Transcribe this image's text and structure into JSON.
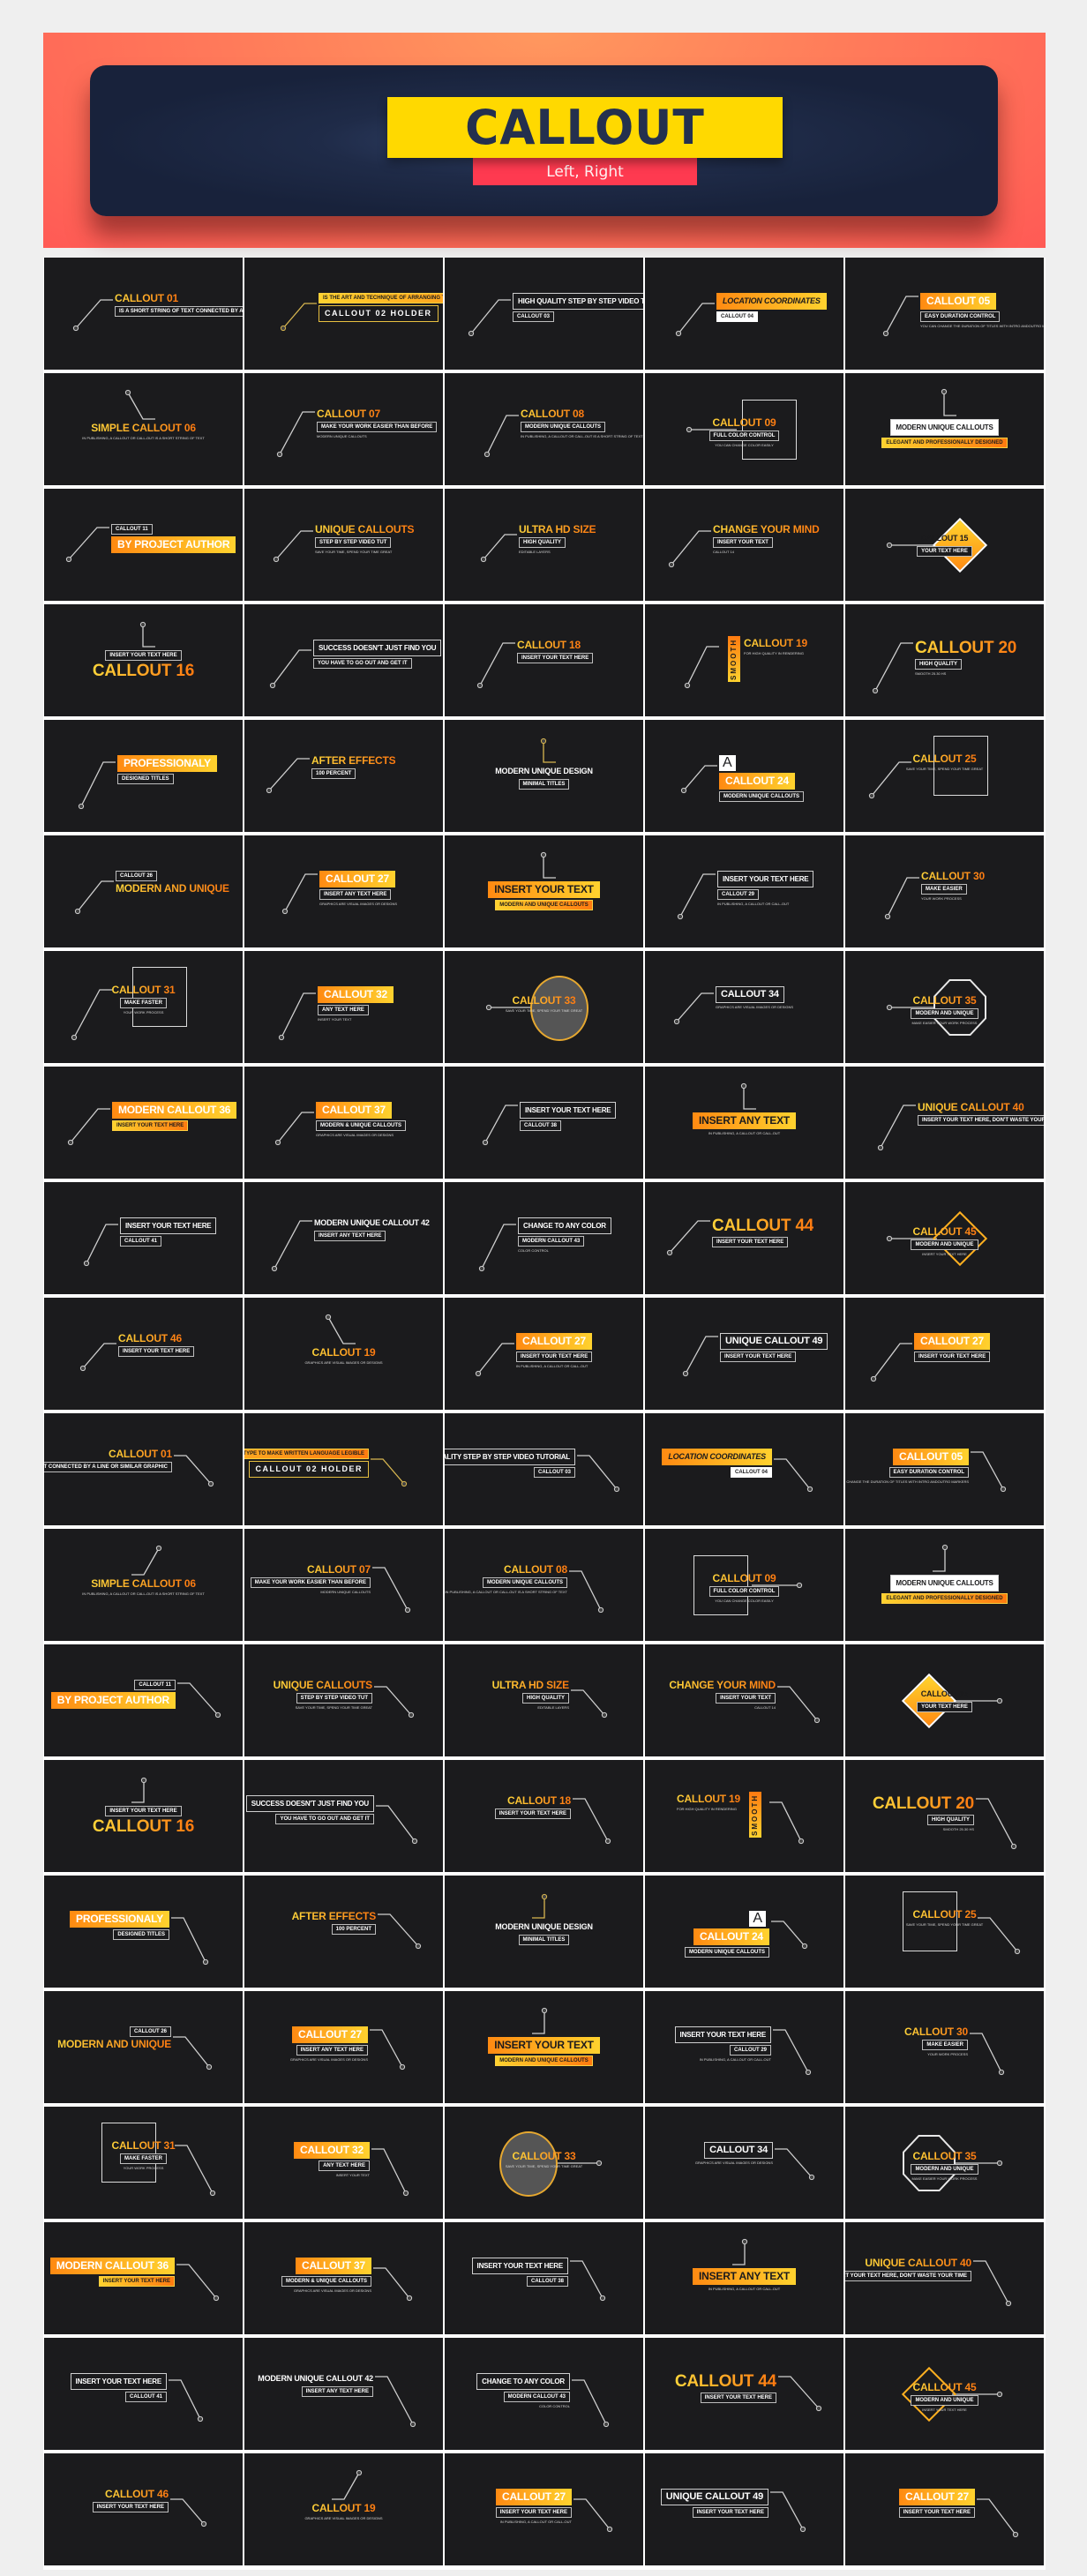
{
  "header": {
    "title": "CALLOUT",
    "subtitle": "Left, Right",
    "colors": {
      "title_bg": "#ffd900",
      "title_text": "#24304e",
      "subtitle_bg": "#fe3a50",
      "banner_gradient": [
        "#ff985e",
        "#ff5a55"
      ],
      "panel": "#1f2b48"
    }
  },
  "grid": {
    "tile_bg": "#1b1b1d",
    "accent_gradient": [
      "#ffd43a",
      "#ff7a10"
    ],
    "tiles_left": [
      {
        "n": 1,
        "title": "CALLOUT 01",
        "sub": "IS A SHORT STRING OF TEXT CONNECTED BY A LINE OR SIMILAR GRAPHIC",
        "style": "line"
      },
      {
        "n": 2,
        "title": "CALLOUT 02 HOLDER",
        "sub": "IS THE ART AND TECHNIQUE OF ARRANGING TYPE TO MAKE WRITTEN LANGUAGE LEGIBLE",
        "style": "holder"
      },
      {
        "n": 3,
        "title": "HIGH QUALITY STEP BY STEP VIDEO TUTORIAL",
        "sub": "CALLOUT 03",
        "style": "boxed"
      },
      {
        "n": 4,
        "title": "LOCATION COORDINATES",
        "sub": "CALLOUT 04",
        "style": "barwhite"
      },
      {
        "n": 5,
        "title": "CALLOUT 05",
        "sub": "EASY DURATION CONTROL",
        "body": "YOU CAN CHANGE THE DURATION OF TITLES WITH INTRO ANDOUTRO MARKERS",
        "style": "bar"
      },
      {
        "n": 6,
        "title": "SIMPLE CALLOUT 06",
        "body": "IN PUBLISHING, A CALLOUT OR CALL-OUT IS A SHORT STRING OF TEXT",
        "style": "bottom"
      },
      {
        "n": 7,
        "title": "CALLOUT 07",
        "sub": "MAKE YOUR WORK EASIER THAN BEFORE",
        "body": "MODERN UNIQUE CALLOUTS",
        "style": "line"
      },
      {
        "n": 8,
        "title": "CALLOUT 08",
        "sub": "MODERN UNIQUE CALLOUTS",
        "body": "IN PUBLISHING, A CALLOUT OR CALL-OUT IS A SHORT STRING OF TEXT",
        "style": "line"
      },
      {
        "n": 9,
        "title": "CALLOUT 09",
        "sub": "FULL COLOR CONTROL",
        "body": "YOU CAN CHANGE COLOR EASILY",
        "style": "frame"
      },
      {
        "n": 10,
        "title": "MODERN UNIQUE CALLOUTS",
        "sub": "ELEGANT AND PROFESSIONALLY DESIGNED",
        "style": "topwhite"
      },
      {
        "n": 11,
        "title": "BY PROJECT AUTHOR",
        "sub": "CALLOUT 11",
        "style": "bar"
      },
      {
        "n": 12,
        "title": "UNIQUE CALLOUTS",
        "sub": "STEP BY STEP VIDEO TUT",
        "body": "SAVE YOUR TIME, SPEND YOUR TIME GREAT",
        "style": "line"
      },
      {
        "n": 13,
        "title": "ULTRA HD SIZE",
        "sub": "HIGH QUALITY",
        "body": "EDITABLE LAYERS",
        "style": "line"
      },
      {
        "n": 14,
        "title": "CHANGE YOUR MIND",
        "sub": "INSERT YOUR TEXT",
        "body": "CALLOUT 14",
        "style": "line"
      },
      {
        "n": 15,
        "title": "CALLOUT 15",
        "sub": "YOUR TEXT HERE",
        "style": "diamond"
      },
      {
        "n": 16,
        "title": "CALLOUT 16",
        "sub": "INSERT YOUR TEXT HERE",
        "style": "top"
      },
      {
        "n": 17,
        "title": "SUCCESS DOESN'T JUST FIND YOU",
        "sub": "YOU HAVE TO GO OUT AND GET IT",
        "style": "boxed"
      },
      {
        "n": 18,
        "title": "CALLOUT 18",
        "sub": "INSERT YOUR TEXT HERE",
        "style": "line"
      },
      {
        "n": 19,
        "title": "CALLOUT 19",
        "sub": "SMOOTH",
        "body": "FOR HIGH QUALITY IN RENDERING",
        "style": "smooth"
      },
      {
        "n": 20,
        "title": "CALLOUT 20",
        "sub": "HIGH QUALITY",
        "body": "SMOOTH 25.30 HS",
        "style": "line"
      },
      {
        "n": 21,
        "title": "PROFESSIONALY",
        "sub": "DESIGNED TITLES",
        "style": "bar"
      },
      {
        "n": 22,
        "title": "AFTER EFFECTS",
        "sub": "100 PERCENT",
        "style": "line"
      },
      {
        "n": 23,
        "title": "MODERN UNIQUE DESIGN",
        "sub": "MINIMAL TITLES",
        "style": "top"
      },
      {
        "n": 24,
        "title": "CALLOUT 24",
        "sub": "MODERN UNIQUE CALLOUTS",
        "glyph": "A",
        "style": "bar"
      },
      {
        "n": 25,
        "title": "CALLOUT 25",
        "body": "SAVE YOUR TIME, SPEND YOUR TIME GREAT",
        "style": "frame"
      },
      {
        "n": 26,
        "title": "MODERN AND UNIQUE",
        "sub": "CALLOUT 26",
        "style": "line"
      },
      {
        "n": 27,
        "title": "CALLOUT 27",
        "sub": "INSERT ANY TEXT HERE",
        "body": "GRAPHICS ARE VISUAL IMAGES OR DESIGNS",
        "style": "bar"
      },
      {
        "n": 28,
        "title": "INSERT YOUR TEXT",
        "sub": "MODERN AND UNIQUE CALLOUTS",
        "style": "topbar"
      },
      {
        "n": 29,
        "title": "INSERT YOUR TEXT HERE",
        "sub": "CALLOUT 29",
        "body": "IN PUBLISHING, A CALLOUT OR CALL-OUT",
        "style": "boxed"
      },
      {
        "n": 30,
        "title": "CALLOUT 30",
        "sub": "MAKE EASIER",
        "body": "YOUR WORK PROCESS",
        "style": "line"
      },
      {
        "n": 31,
        "title": "CALLOUT 31",
        "sub": "MAKE FASTER",
        "body": "YOUR WORK PROCESS",
        "style": "frame"
      },
      {
        "n": 32,
        "title": "CALLOUT 32",
        "sub": "ANY TEXT HERE",
        "body": "INSERT YOUR TEXT",
        "style": "bar"
      },
      {
        "n": 33,
        "title": "CALLOUT 33",
        "body": "SAVE YOUR TIME, SPEND YOUR TIME GREAT",
        "style": "circle"
      },
      {
        "n": 34,
        "title": "CALLOUT 34",
        "body": "GRAPHICS ARE VISUAL IMAGES OR DESIGNS",
        "style": "boxed"
      },
      {
        "n": 35,
        "title": "CALLOUT 35",
        "sub": "MODERN AND UNIQUE",
        "body": "MAKE EASIER YOUR WORK PROCESS",
        "style": "octa"
      },
      {
        "n": 36,
        "title": "MODERN CALLOUT 36",
        "sub": "INSERT YOUR TEXT HERE",
        "style": "bar"
      },
      {
        "n": 37,
        "title": "CALLOUT 37",
        "sub": "MODERN & UNIQUE CALLOUTS",
        "body": "GRAPHICS ARE VISUAL IMAGES OR DESIGNS",
        "style": "bar"
      },
      {
        "n": 38,
        "title": "INSERT YOUR TEXT HERE",
        "sub": "CALLOUT 38",
        "style": "boxed"
      },
      {
        "n": 39,
        "title": "INSERT ANY TEXT",
        "body": "IN PUBLISHING, A CALLOUT OR CALL-OUT",
        "style": "topbar"
      },
      {
        "n": 40,
        "title": "UNIQUE CALLOUT 40",
        "sub": "INSERT YOUR TEXT HERE, DON'T WASTE YOUR TIME",
        "style": "line"
      },
      {
        "n": 41,
        "title": "INSERT YOUR TEXT HERE",
        "sub": "CALLOUT 41",
        "style": "boxed"
      },
      {
        "n": 42,
        "title": "MODERN UNIQUE CALLOUT 42",
        "sub": "INSERT ANY TEXT HERE",
        "style": "line"
      },
      {
        "n": 43,
        "title": "CHANGE TO ANY COLOR",
        "sub": "MODERN CALLOUT 43",
        "body": "COLOR CONTROL",
        "style": "boxed"
      },
      {
        "n": 44,
        "title": "CALLOUT 44",
        "sub": "INSERT YOUR TEXT HERE",
        "style": "line"
      },
      {
        "n": 45,
        "title": "CALLOUT 45",
        "sub": "MODERN AND UNIQUE",
        "body": "INSERT YOUR TEXT HERE",
        "style": "diamond-outline"
      },
      {
        "n": 46,
        "title": "CALLOUT 46",
        "sub": "INSERT YOUR TEXT HERE",
        "style": "line"
      },
      {
        "n": 47,
        "title": "CALLOUT 19",
        "body": "GRAPHICS ARE VISUAL IMAGES OR DESIGNS",
        "style": "bottom"
      },
      {
        "n": 48,
        "title": "CALLOUT 27",
        "sub": "INSERT YOUR TEXT HERE",
        "body": "IN PUBLISHING, A CALLOUT OR CALL-OUT",
        "style": "bar"
      },
      {
        "n": 49,
        "title": "UNIQUE CALLOUT 49",
        "sub": "INSERT YOUR TEXT HERE",
        "style": "boxed"
      },
      {
        "n": 50,
        "title": "CALLOUT 27",
        "sub": "INSERT YOUR TEXT HERE",
        "style": "bar"
      }
    ]
  }
}
